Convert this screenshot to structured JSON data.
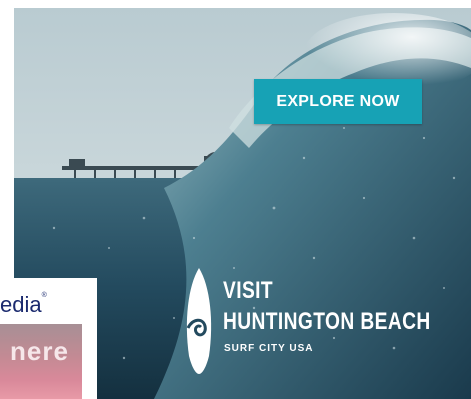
{
  "ad": {
    "cta_label": "EXPLORE NOW",
    "logo": {
      "line1": "VISIT",
      "line2": "HUNTINGTON BEACH",
      "tagline": "SURF CITY USA"
    },
    "colors": {
      "cta": "#17a2b5",
      "sky": "#c9d7db",
      "ocean": "#1f4358",
      "text": "#ffffff"
    },
    "icons": [
      "surfboard-icon",
      "wave-icon"
    ]
  },
  "overlap_ad": {
    "brand_text": "edia",
    "trademark": "®",
    "photo_text": "nere"
  }
}
